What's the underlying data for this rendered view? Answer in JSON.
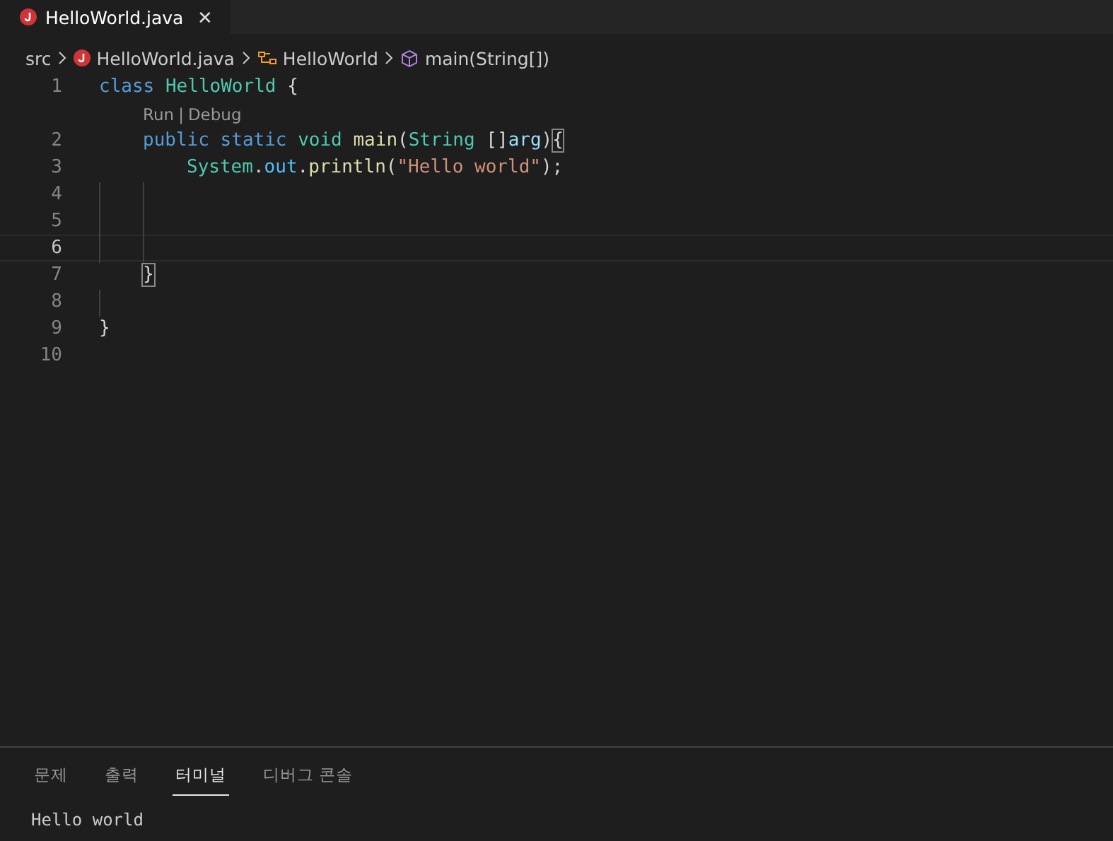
{
  "tabs": [
    {
      "label": "HelloWorld.java",
      "selected": true,
      "close": "✕"
    }
  ],
  "breadcrumb": [
    {
      "kind": "folder",
      "label": "src"
    },
    {
      "kind": "file",
      "label": "HelloWorld.java"
    },
    {
      "kind": "class",
      "label": "HelloWorld"
    },
    {
      "kind": "method",
      "label": "main(String[])"
    }
  ],
  "lines": [
    {
      "number": "1",
      "current": false,
      "tokens": [
        {
          "kind": "keyword",
          "text": "class "
        },
        {
          "kind": "type",
          "text": "HelloWorld"
        },
        {
          "kind": "open",
          "text": " {"
        }
      ],
      "code_lens": {
        "links": [
          "Run",
          "Debug"
        ],
        "separator": "|"
      }
    },
    {
      "number": "2",
      "current": false,
      "tokens": [
        {
          "kind": "keyword",
          "text": "public static "
        },
        {
          "kind": "type",
          "text": "void "
        },
        {
          "kind": "func",
          "text": "main"
        },
        {
          "kind": "plain",
          "text": "("
        },
        {
          "kind": "type",
          "text": "String "
        },
        {
          "kind": "plain",
          "text": "[]"
        },
        {
          "kind": "var",
          "text": "arg"
        },
        {
          "kind": "plain",
          "text": ")"
        },
        {
          "kind": "open_match",
          "text": "{"
        }
      ]
    },
    {
      "number": "3",
      "current": false,
      "tokens": [
        {
          "kind": "type",
          "text": "System"
        },
        {
          "kind": "plain",
          "text": "."
        },
        {
          "kind": "const",
          "text": "out"
        },
        {
          "kind": "plain",
          "text": "."
        },
        {
          "kind": "func",
          "text": "println"
        },
        {
          "kind": "plain",
          "text": "("
        },
        {
          "kind": "string",
          "text": "\"Hello world\""
        },
        {
          "kind": "plain",
          "text": ");"
        }
      ]
    },
    {
      "number": "4",
      "current": false
    },
    {
      "number": "5",
      "current": false
    },
    {
      "number": "6",
      "current": true
    },
    {
      "number": "7",
      "current": false,
      "tokens": [
        {
          "kind": "close_match",
          "text": "}"
        }
      ]
    },
    {
      "number": "8",
      "current": false
    },
    {
      "number": "9",
      "current": false,
      "tokens": [
        {
          "kind": "close",
          "text": "}"
        }
      ]
    },
    {
      "number": "10",
      "current": false
    }
  ],
  "panel": {
    "tabs": [
      {
        "label": "문제",
        "selected": false
      },
      {
        "label": "출력",
        "selected": false
      },
      {
        "label": "터미널",
        "selected": true
      },
      {
        "label": "디버그 콘솔",
        "selected": false
      }
    ],
    "terminal_lines": [
      "Hello world"
    ]
  }
}
